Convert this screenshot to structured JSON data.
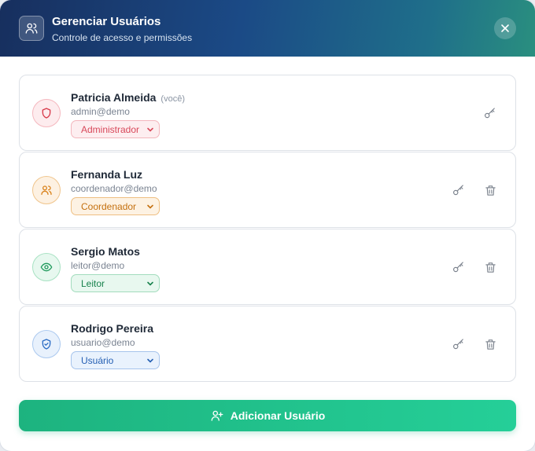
{
  "header": {
    "title": "Gerenciar Usuários",
    "subtitle": "Controle de acesso e permissões",
    "icon": "users-icon",
    "close_icon": "close-icon"
  },
  "users": [
    {
      "name": "Patricia Almeida",
      "you_label": "(você)",
      "email": "admin@demo",
      "role": "Administrador",
      "avatar_icon": "shield-icon",
      "colors": {
        "bg": "#fdecee",
        "border": "#f5b8bf",
        "fg": "#d83a4a",
        "select_bg": "#fdeef0",
        "select_border": "#f3b6bd",
        "select_text": "#d8485a"
      },
      "actions": [
        "key-icon"
      ]
    },
    {
      "name": "Fernanda Luz",
      "email": "coordenador@demo",
      "role": "Coordenador",
      "avatar_icon": "users-icon",
      "colors": {
        "bg": "#fdf1e2",
        "border": "#f0c58c",
        "fg": "#d9821b",
        "select_bg": "#fdf2e3",
        "select_border": "#eebf82",
        "select_text": "#c4700f"
      },
      "actions": [
        "key-icon",
        "trash-icon"
      ]
    },
    {
      "name": "Sergio Matos",
      "email": "leitor@demo",
      "role": "Leitor",
      "avatar_icon": "eye-icon",
      "colors": {
        "bg": "#e7f8ef",
        "border": "#a8e2c3",
        "fg": "#1f9a5c",
        "select_bg": "#e8f8ef",
        "select_border": "#a2dcbd",
        "select_text": "#17814c"
      },
      "actions": [
        "key-icon",
        "trash-icon"
      ]
    },
    {
      "name": "Rodrigo Pereira",
      "email": "usuario@demo",
      "role": "Usuário",
      "avatar_icon": "shield-check-icon",
      "colors": {
        "bg": "#e8f1fc",
        "border": "#abc9ef",
        "fg": "#2b6cc4",
        "select_bg": "#e9f2fd",
        "select_border": "#a6c4ec",
        "select_text": "#245fb3"
      },
      "actions": [
        "key-icon",
        "trash-icon"
      ]
    }
  ],
  "add_button": {
    "label": "Adicionar Usuário",
    "icon": "user-plus-icon"
  }
}
